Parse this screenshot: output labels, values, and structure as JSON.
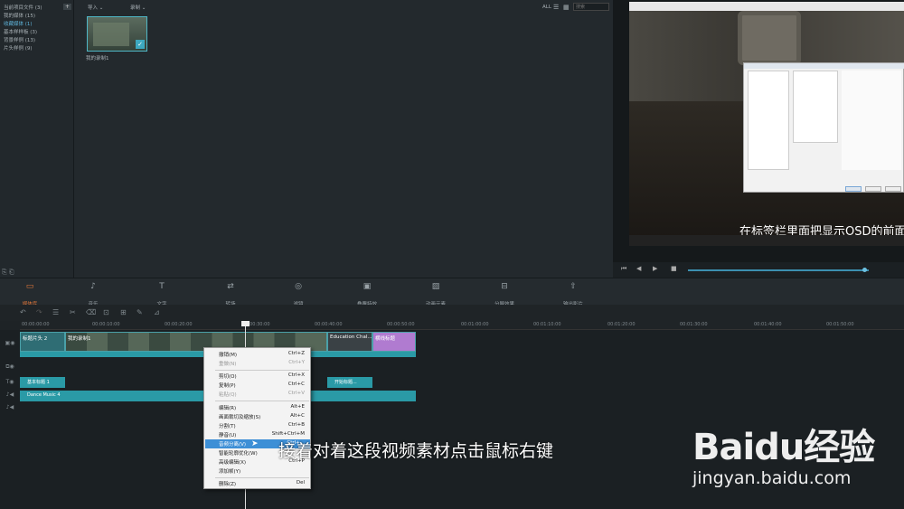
{
  "library": {
    "items": [
      "当前项目文件 (3)",
      "我的媒体 (15)",
      "收藏媒体 (1)",
      "基本样样板 (3)",
      "背景样例 (13)",
      "片头样例 (9)"
    ]
  },
  "media_toolbar": {
    "import_label": "导入 ⌄",
    "record_label": "录制 ⌄",
    "view_all": "ALL",
    "search_placeholder": "搜索"
  },
  "media_item": {
    "label": "我的录制1"
  },
  "preview": {
    "subtitle": "在标签栏里面把显示OSD的前面的"
  },
  "toolbar": {
    "items": [
      {
        "icon": "folder-icon",
        "label": "媒体库"
      },
      {
        "icon": "music-icon",
        "label": "音乐"
      },
      {
        "icon": "text-icon",
        "label": "文字"
      },
      {
        "icon": "transition-icon",
        "label": "转场"
      },
      {
        "icon": "filter-icon",
        "label": "滤镜"
      },
      {
        "icon": "overlay-icon",
        "label": "叠覆特效"
      },
      {
        "icon": "element-icon",
        "label": "动画元素"
      },
      {
        "icon": "split-icon",
        "label": "分屏效果"
      },
      {
        "icon": "export-icon",
        "label": "输出影片"
      }
    ]
  },
  "ruler": {
    "ticks": [
      "00:00:00:00",
      "00:00:10:00",
      "00:00:20:00",
      "00:00:30:00",
      "00:00:40:00",
      "00:00:50:00",
      "00:01:00:00",
      "00:01:10:00",
      "00:01:20:00",
      "00:01:30:00",
      "00:01:40:00",
      "00:01:50:00",
      "00:02:00:00"
    ]
  },
  "timeline": {
    "clip_intro": "标题片头 2",
    "clip_recording": "我的录制1",
    "clip_education": "Education Chal...",
    "clip_last": "横线标题",
    "text_clip_1": "基本标题 1",
    "text_clip_2": "开始标题...",
    "audio_clip": "Dance Music 4"
  },
  "context_menu": {
    "items": [
      {
        "label": "撤销(M)",
        "shortcut": "Ctrl+Z",
        "disabled": false
      },
      {
        "label": "重做(N)",
        "shortcut": "Ctrl+Y",
        "disabled": true
      },
      {
        "label": "剪切(O)",
        "shortcut": "Ctrl+X",
        "disabled": false
      },
      {
        "label": "复制(P)",
        "shortcut": "Ctrl+C",
        "disabled": false
      },
      {
        "label": "粘贴(Q)",
        "shortcut": "Ctrl+V",
        "disabled": true
      },
      {
        "label": "编辑(R)",
        "shortcut": "Alt+E",
        "disabled": false
      },
      {
        "label": "画面裁切及缩放(S)",
        "shortcut": "Alt+C",
        "disabled": false
      },
      {
        "label": "分割(T)",
        "shortcut": "Ctrl+B",
        "disabled": false
      },
      {
        "label": "静音(U)",
        "shortcut": "Shift+Ctrl+M",
        "disabled": false
      },
      {
        "label": "音频分离(V)",
        "shortcut": "Ctrl+...",
        "disabled": false,
        "highlighted": true
      },
      {
        "label": "智能轮廓优化(W)",
        "shortcut": "",
        "disabled": false
      },
      {
        "label": "高级编辑(X)",
        "shortcut": "Ctrl+P",
        "disabled": false
      },
      {
        "label": "添加帧(Y)",
        "shortcut": "",
        "disabled": false
      },
      {
        "label": "删除(Z)",
        "shortcut": "Del",
        "disabled": false
      }
    ]
  },
  "caption": "接着对着这段视频素材点击鼠标右键",
  "watermark": {
    "brand": "Baidu经验",
    "url": "jingyan.baidu.com"
  },
  "colors": {
    "accent": "#e0763a",
    "clip": "#2f6d74",
    "audio": "#2a9aa6",
    "menu_highlight": "#3d8fd6"
  }
}
